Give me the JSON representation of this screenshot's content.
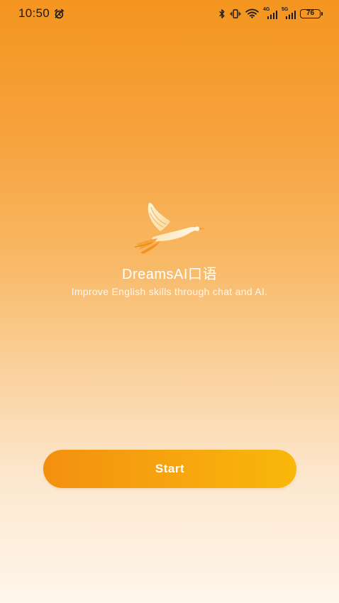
{
  "status_bar": {
    "time": "10:50",
    "network_1": "4G",
    "network_2": "5G",
    "battery": "76",
    "icons": [
      "alarm-icon",
      "bluetooth-icon",
      "vibrate-icon",
      "wifi-icon",
      "signal-icon",
      "signal-icon",
      "battery-icon"
    ]
  },
  "splash": {
    "logo_icon": "flying-bird-logo",
    "app_name": "DreamsAI口语",
    "tagline": "Improve English skills through chat and AI."
  },
  "actions": {
    "start_label": "Start"
  },
  "colors": {
    "background_top": "#f4951f",
    "background_bottom": "#fff6ec",
    "button_start": "#f3900f",
    "button_end": "#f9b80a",
    "text": "#ffffff"
  }
}
